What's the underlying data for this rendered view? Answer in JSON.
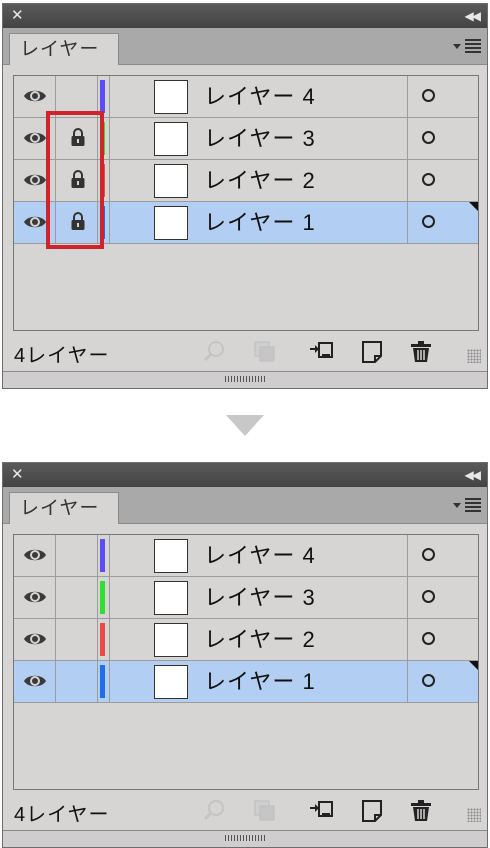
{
  "panels": [
    {
      "id": "before",
      "tab_label": "レイヤー",
      "count_label": "4レイヤー",
      "layers": [
        {
          "name": "レイヤー 4",
          "color": "#5c4cff",
          "locked": false,
          "visible": true,
          "selected": false
        },
        {
          "name": "レイヤー 3",
          "color": "#2fe02f",
          "locked": true,
          "visible": true,
          "selected": false
        },
        {
          "name": "レイヤー 2",
          "color": "#f04848",
          "locked": true,
          "visible": true,
          "selected": false
        },
        {
          "name": "レイヤー 1",
          "color": "#1e6ef0",
          "locked": true,
          "visible": true,
          "selected": true
        }
      ]
    },
    {
      "id": "after",
      "tab_label": "レイヤー",
      "count_label": "4レイヤー",
      "layers": [
        {
          "name": "レイヤー 4",
          "color": "#5c4cff",
          "locked": false,
          "visible": true,
          "selected": false
        },
        {
          "name": "レイヤー 3",
          "color": "#2fe02f",
          "locked": false,
          "visible": true,
          "selected": false
        },
        {
          "name": "レイヤー 2",
          "color": "#f04848",
          "locked": false,
          "visible": true,
          "selected": false
        },
        {
          "name": "レイヤー 1",
          "color": "#1e6ef0",
          "locked": false,
          "visible": true,
          "selected": true
        }
      ]
    }
  ],
  "icons": {
    "close": "close-icon",
    "collapse": "collapse-icon",
    "menu": "panel-menu-icon",
    "visibility": "eye-icon",
    "lock": "lock-icon",
    "target": "target-circle-icon",
    "search": "locate-object-icon",
    "clipping": "clipping-mask-icon",
    "new_sublayer": "new-sublayer-icon",
    "new_layer": "new-layer-icon",
    "delete": "trash-icon"
  },
  "highlight_color": "#d2232a"
}
